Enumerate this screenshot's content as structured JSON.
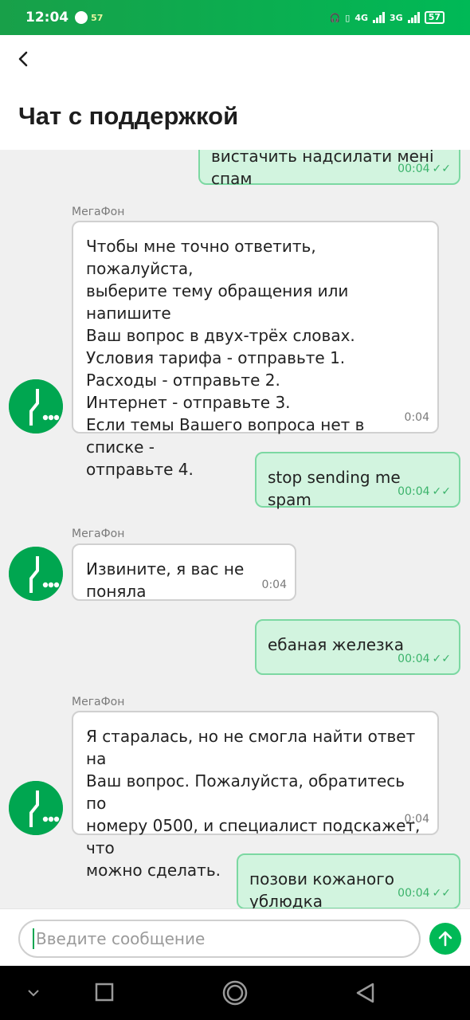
{
  "status": {
    "time": "12:04",
    "battery": "57",
    "net1": "4G",
    "net2": "3G"
  },
  "header": {
    "title": "Чат с поддержкой"
  },
  "messages": [
    {
      "who": "me",
      "text": "вистачить надсилати мені спам",
      "time": "00:04"
    },
    {
      "who": "them",
      "sender": "МегаФон",
      "text": "Чтобы мне точно ответить, пожалуйста,\nвыберите тему обращения или напишите\nВаш вопрос в двух-трёх словах.\nУсловия тарифа - отправьте 1.\nРасходы - отправьте 2.\nИнтернет - отправьте 3.\nЕсли темы Вашего вопроса нет в списке -\nотправьте 4.",
      "time": "0:04"
    },
    {
      "who": "me",
      "text": "stop sending me spam",
      "time": "00:04"
    },
    {
      "who": "them",
      "sender": "МегаФон",
      "text": "Извините, я вас не поняла",
      "time": "0:04"
    },
    {
      "who": "me",
      "text": "ебаная железка",
      "time": "00:04"
    },
    {
      "who": "them",
      "sender": "МегаФон",
      "text": "Я старалась, но не смогла найти ответ на\nВаш вопрос. Пожалуйста, обратитесь по\nномеру 0500, и специалист подскажет, что\nможно сделать.",
      "time": "0:04"
    },
    {
      "who": "me",
      "text": "позови кожаного ублюдка",
      "time": "00:04"
    }
  ],
  "composer": {
    "placeholder": "Введите сообщение"
  },
  "colors": {
    "accent": "#00b956",
    "outgoing_bg": "#d2f4df"
  }
}
